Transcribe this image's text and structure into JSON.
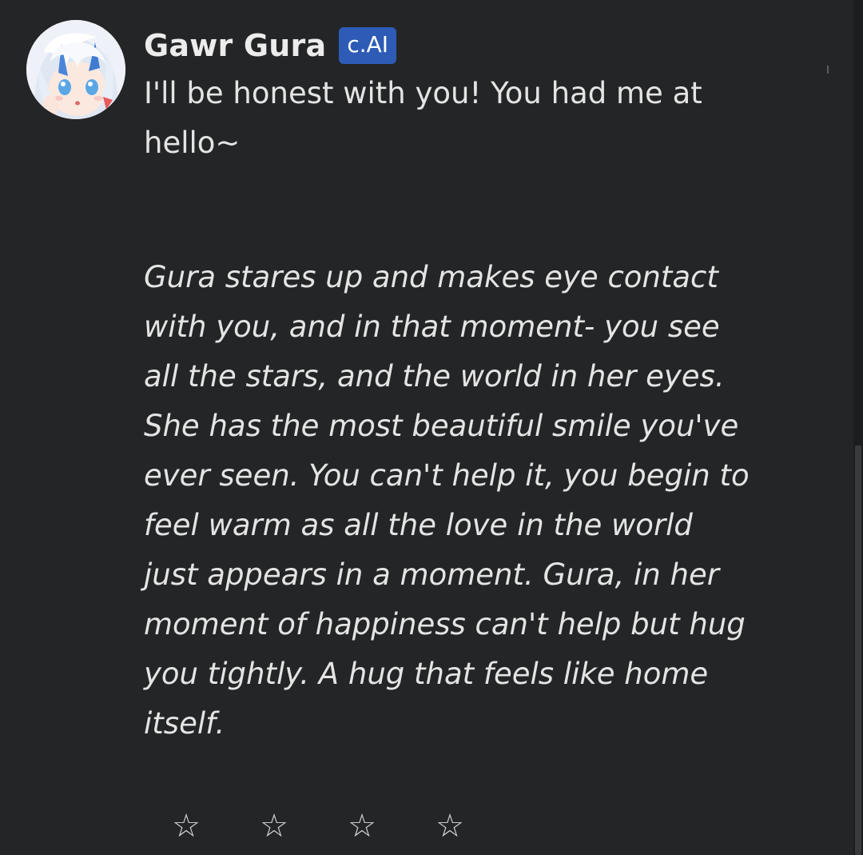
{
  "message": {
    "character_name": "Gawr Gura",
    "badge_label": "c.AI",
    "greeting_text": "I'll be honest with you! You had me at hello~",
    "action_text": "Gura stares up and makes eye contact with you, and in that moment- you see all the stars, and the world in her eyes. She has the most beautiful smile you've ever seen. You can't help it, you begin to feel warm as all the love in the world just appears in a moment. Gura, in her moment of happiness can't help but hug you tightly. A hug that feels like home itself."
  },
  "rating": {
    "stars": [
      "☆",
      "☆",
      "☆",
      "☆"
    ],
    "value": 0,
    "max": 4
  },
  "colors": {
    "background": "#242526",
    "text": "#e4e4e4",
    "badge": "#2d5bb5"
  },
  "icons": {
    "star": "star-outline-icon",
    "avatar": "character-avatar-image"
  }
}
